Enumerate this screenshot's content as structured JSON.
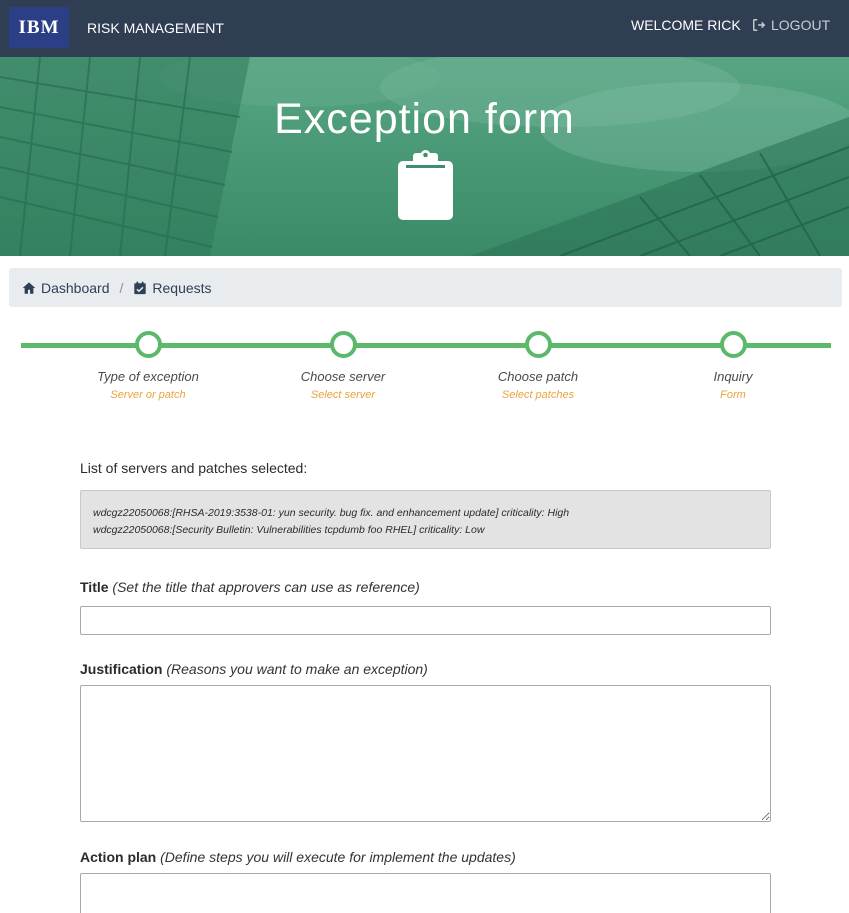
{
  "navbar": {
    "logo_text": "IBM",
    "brand": "RISK MANAGEMENT",
    "welcome": "WELCOME RICK",
    "logout": "LOGOUT"
  },
  "hero": {
    "title": "Exception form",
    "icon": "clipboard-icon"
  },
  "breadcrumb": [
    {
      "label": "Dashboard",
      "icon": "home-icon"
    },
    {
      "label": "Requests",
      "icon": "calendar-check-icon"
    }
  ],
  "stepper": {
    "steps": [
      {
        "label": "Type of exception",
        "sub": "Server or patch"
      },
      {
        "label": "Choose server",
        "sub": "Select server"
      },
      {
        "label": "Choose patch",
        "sub": "Select patches"
      },
      {
        "label": "Inquiry",
        "sub": "Form"
      }
    ]
  },
  "form": {
    "list_label": "List of servers and patches selected:",
    "selected": [
      "wdcgz22050068:[RHSA-2019:3538-01: yun security. bug fix. and enhancement update] criticality: High",
      "wdcgz22050068:[Security Bulletin: Vulnerabilities tcpdumb foo RHEL] criticality: Low"
    ],
    "title_label": "Title",
    "title_hint": "(Set the title that approvers can use as reference)",
    "title_value": "",
    "justification_label": "Justification",
    "justification_hint": "(Reasons you want to make an exception)",
    "justification_value": "",
    "action_label": "Action plan",
    "action_hint": "(Define steps you will execute for implement the updates)",
    "action_value": ""
  },
  "colors": {
    "navbar": "#2f3e52",
    "accent_green": "#5cb86a",
    "step_sub": "#e8a33c",
    "hero_green": "#3d8f6f"
  }
}
